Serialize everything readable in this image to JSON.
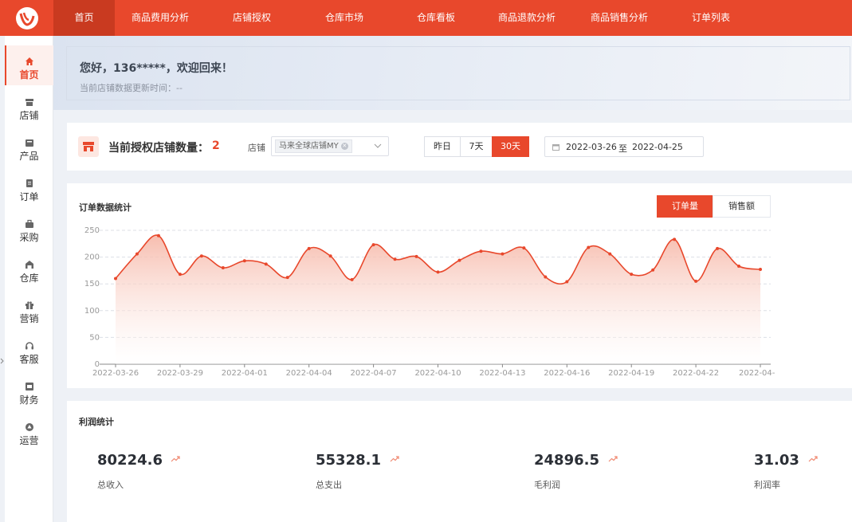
{
  "nav": {
    "items": [
      "首页",
      "商品费用分析",
      "店铺授权",
      "仓库市场",
      "仓库看板",
      "商品退款分析",
      "商品销售分析",
      "订单列表"
    ],
    "active_index": 0
  },
  "sidebar": {
    "items": [
      {
        "label": "首页",
        "icon": "home-icon"
      },
      {
        "label": "店铺",
        "icon": "shop-icon"
      },
      {
        "label": "产品",
        "icon": "product-icon"
      },
      {
        "label": "订单",
        "icon": "order-icon"
      },
      {
        "label": "采购",
        "icon": "purchase-icon"
      },
      {
        "label": "仓库",
        "icon": "warehouse-icon"
      },
      {
        "label": "营销",
        "icon": "gift-icon"
      },
      {
        "label": "客服",
        "icon": "headset-icon"
      },
      {
        "label": "财务",
        "icon": "finance-icon"
      },
      {
        "label": "运营",
        "icon": "operations-icon"
      }
    ],
    "active_index": 0
  },
  "banner": {
    "welcome": "您好，136*****，欢迎回来！",
    "update_label": "当前店铺数据更新时间：--"
  },
  "store": {
    "title": "当前授权店铺数量：",
    "count": "2",
    "label": "店铺",
    "selected_tag": "马来全球店铺MY",
    "ranges": [
      "昨日",
      "7天",
      "30天"
    ],
    "active_range_index": 2,
    "date_start": "2022-03-26",
    "date_sep": "至",
    "date_end": "2022-04-25"
  },
  "orders": {
    "title": "订单数据统计",
    "toggles": [
      "订单量",
      "销售额"
    ],
    "active_toggle_index": 0
  },
  "chart_data": {
    "type": "area",
    "x": [
      "2022-03-26",
      "2022-03-27",
      "2022-03-28",
      "2022-03-29",
      "2022-03-30",
      "2022-03-31",
      "2022-04-01",
      "2022-04-02",
      "2022-04-03",
      "2022-04-04",
      "2022-04-05",
      "2022-04-06",
      "2022-04-07",
      "2022-04-08",
      "2022-04-09",
      "2022-04-10",
      "2022-04-11",
      "2022-04-12",
      "2022-04-13",
      "2022-04-14",
      "2022-04-15",
      "2022-04-16",
      "2022-04-17",
      "2022-04-18",
      "2022-04-19",
      "2022-04-20",
      "2022-04-21",
      "2022-04-22",
      "2022-04-23",
      "2022-04-24",
      "2022-04-25"
    ],
    "values": [
      160,
      206,
      240,
      168,
      202,
      180,
      193,
      187,
      162,
      216,
      202,
      158,
      223,
      196,
      201,
      172,
      194,
      211,
      206,
      217,
      163,
      154,
      218,
      206,
      168,
      176,
      233,
      155,
      216,
      183,
      177
    ],
    "xticks": [
      "2022-03-26",
      "2022-03-29",
      "2022-04-01",
      "2022-04-04",
      "2022-04-07",
      "2022-04-10",
      "2022-04-13",
      "2022-04-16",
      "2022-04-19",
      "2022-04-22",
      "2022-04-"
    ],
    "yticks": [
      0,
      50,
      100,
      150,
      200,
      250
    ],
    "ylim": [
      0,
      250
    ],
    "grid": true,
    "colors": {
      "line": "#e8482c",
      "fill_top": "#f6b6a6",
      "fill_bottom": "#ffffff",
      "grid": "#dcdfe6"
    }
  },
  "profit": {
    "title": "利润统计",
    "stats": [
      {
        "value": "80224.6",
        "label": "总收入"
      },
      {
        "value": "55328.1",
        "label": "总支出"
      },
      {
        "value": "24896.5",
        "label": "毛利润"
      },
      {
        "value": "31.03",
        "label": "利润率"
      }
    ]
  },
  "colors": {
    "accent": "#e8482c",
    "accent_dark": "#c93a20",
    "page_bg": "#eef1f6"
  }
}
